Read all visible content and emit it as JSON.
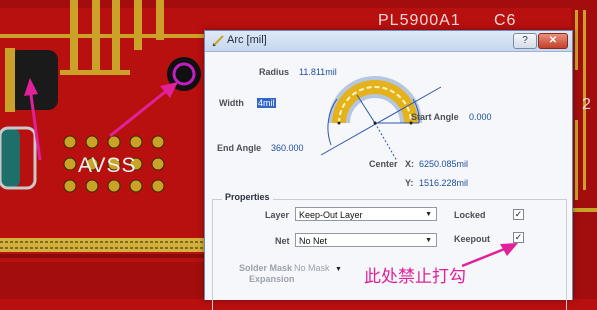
{
  "board": {
    "silkscreen_text_top": "PL5900A1",
    "silkscreen_text_c6": "C6",
    "silkscreen_text_avss": "AVSS",
    "edge_digit": "2",
    "colors": {
      "board_red": "#b80f0f",
      "pad_yellow": "#c9a227",
      "arrow_magenta": "#e0219a"
    }
  },
  "dialog": {
    "title": "Arc [mil]",
    "help_button": "?",
    "close_button": "✕",
    "radius_label": "Radius",
    "radius_value": "11.811mil",
    "width_label": "Width",
    "width_value": "4mil",
    "start_angle_label": "Start Angle",
    "start_angle_value": "0.000",
    "end_angle_label": "End Angle",
    "end_angle_value": "360.000",
    "center_label": "Center",
    "x_label": "X:",
    "x_value": "6250.085mil",
    "y_label": "Y:",
    "y_value": "1516.228mil",
    "properties_title": "Properties",
    "layer_label": "Layer",
    "layer_value": "Keep-Out Layer",
    "net_label": "Net",
    "net_value": "No Net",
    "locked_label": "Locked",
    "locked_checked": true,
    "keepout_label": "Keepout",
    "keepout_checked": true,
    "solder_mask_label": "Solder Mask",
    "solder_mask_label2": "Expansion",
    "solder_mask_value": "No Mask"
  },
  "annotation": {
    "note": "此处禁止打勾"
  }
}
